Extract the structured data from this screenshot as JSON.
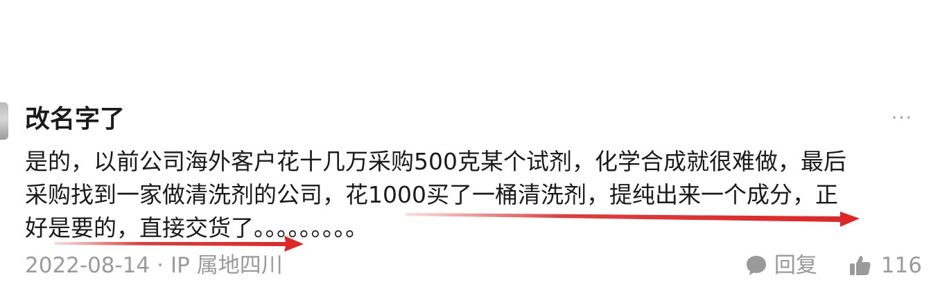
{
  "comment": {
    "username": "改名字了",
    "more_label": "···",
    "lines": [
      "是的，以前公司海外客户花十几万采购500克某个试剂，化学合成就很难做，最后",
      "采购找到一家做清洗剂的公司，花1000买了一桶清洗剂，提纯出来一个成分，正",
      "好是要的，直接交货了。。。。。。。。。"
    ],
    "date": "2022-08-14",
    "separator": "·",
    "ip_location": "IP 属地四川",
    "reply_label": "回复",
    "like_count": "116"
  },
  "icons": {
    "reply": "speech-bubble-icon",
    "like": "thumbs-up-icon",
    "more": "more-dots-icon"
  },
  "colors": {
    "text": "#1a1a1a",
    "meta": "#9a9a9a",
    "annotation_arrow": "#e02424"
  }
}
